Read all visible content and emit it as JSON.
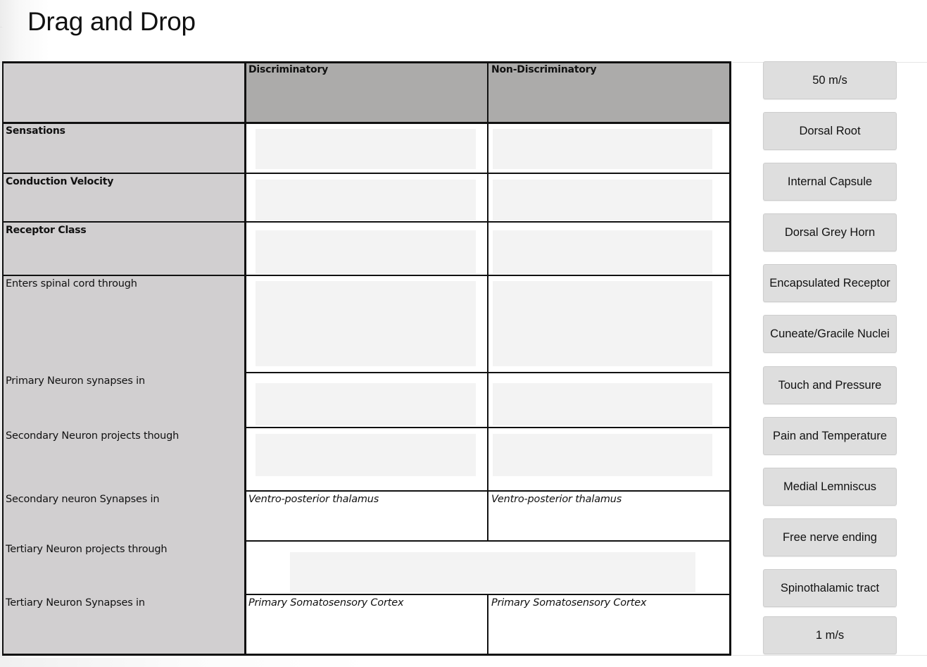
{
  "page": {
    "title": "Drag and Drop"
  },
  "table": {
    "columns": [
      "",
      "Discriminatory",
      "Non-Discriminatory"
    ],
    "rows": [
      {
        "label": "Sensations",
        "bold": true,
        "discriminatory": "",
        "non_discriminatory": ""
      },
      {
        "label": "Conduction Velocity",
        "bold": true,
        "discriminatory": "",
        "non_discriminatory": ""
      },
      {
        "label": "Receptor Class",
        "bold": true,
        "discriminatory": "",
        "non_discriminatory": ""
      },
      {
        "label": "Enters spinal cord through",
        "bold": false,
        "discriminatory": "",
        "non_discriminatory": ""
      },
      {
        "label": "Primary Neuron synapses in",
        "bold": false,
        "discriminatory": "",
        "non_discriminatory": ""
      },
      {
        "label": "Secondary Neuron projects though",
        "bold": false,
        "discriminatory": "",
        "non_discriminatory": ""
      },
      {
        "label": "Secondary neuron Synapses in",
        "bold": false,
        "discriminatory": "Ventro-posterior thalamus",
        "non_discriminatory": "Ventro-posterior thalamus"
      },
      {
        "label": "Tertiary Neuron projects through",
        "bold": false,
        "merged": true,
        "discriminatory": "",
        "non_discriminatory": ""
      },
      {
        "label": "Tertiary Neuron Synapses in",
        "bold": false,
        "discriminatory": "Primary Somatosensory Cortex",
        "non_discriminatory": "Primary Somatosensory Cortex"
      }
    ]
  },
  "draggables": [
    "50 m/s",
    "Dorsal Root",
    "Internal Capsule",
    "Dorsal Grey Horn",
    "Encapsulated Receptor",
    "Cuneate/Gracile Nuclei",
    "Touch and Pressure",
    "Pain and Temperature",
    "Medial Lemniscus",
    "Free nerve ending",
    "Spinothalamic tract",
    "1 m/s"
  ],
  "colors": {
    "label_column": "#d1cfd0",
    "header_row": "#acabaa",
    "drop_zone": "#f3f3f3",
    "chip": "#dedede"
  }
}
